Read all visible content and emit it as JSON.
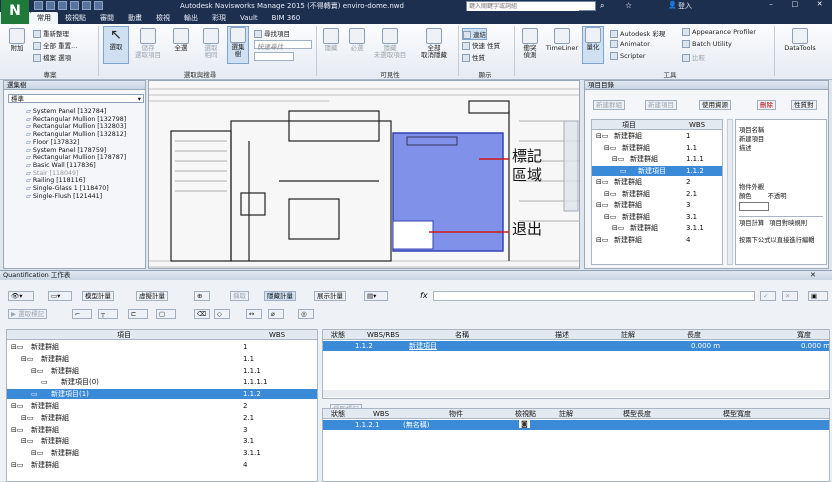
{
  "window_title": "Autodesk Navisworks Manage 2015 (不得轉賣)    enviro-dome.nwd",
  "search": {
    "placeholder": "鍵入關鍵字或詞組"
  },
  "user": {
    "name": "登入"
  },
  "ribbon_tabs": [
    "常用",
    "檢視點",
    "審閱",
    "動畫",
    "檢視",
    "輸出",
    "彩現",
    "Vault",
    "BIM 360"
  ],
  "ribbon": {
    "append": "附加",
    "refresh": "重新整理",
    "reset_all": "全部 重置...",
    "file_options": "檔案 選項",
    "select": "選取",
    "save_selection": "儲存\n選取項目",
    "select_all": "全選",
    "select_same": "選取\n相同",
    "selection_tree": "選集\n樹",
    "find_items": "尋找項目",
    "quick_find": "快速尋找",
    "hide": "隱藏",
    "require": "必選",
    "hide_unselected": "隱藏\n未選取項目",
    "unhide_all": "全部\n取消隱藏",
    "links": "連結",
    "quick_properties": "快速 性質",
    "properties": "性質",
    "clash_detective": "衝突\n偵測",
    "timeliner": "TimeLiner",
    "quantification": "量化",
    "autodesk_rendering": "Autodesk 彩現",
    "animator": "Animator",
    "scripter": "Scripter",
    "appearance_profiler": "Appearance Profiler",
    "batch_utility": "Batch Utility",
    "compare": "比較",
    "datatools": "DataTools",
    "groups": [
      "專案",
      "選取與搜尋",
      "可見性",
      "顯示",
      "工具"
    ]
  },
  "selection_tree": {
    "title": "選集樹",
    "mode": "標準",
    "items": [
      "System Panel [132784]",
      "Rectangular Mullion [132798]",
      "Rectangular Mullion [132803]",
      "Rectangular Mullion [132812]",
      "Floor [137832]",
      "System Panel [178759]",
      "Rectangular Mullion [178787]",
      "Basic Wall [117836]",
      "Stair [118049]",
      "Railing [118116]",
      "Single-Glass 1 [118470]",
      "Single-Flush [121441]"
    ]
  },
  "annotations": {
    "mark_area": "標記\n區域",
    "exit": "退出"
  },
  "item_catalog": {
    "title": "項目目錄",
    "buttons": [
      "新建群組",
      "新建項目",
      "使用資源",
      "刪除",
      "性質對"
    ],
    "columns": [
      "項目",
      "WBS"
    ],
    "rows": [
      {
        "name": "新建群組",
        "wbs": "1",
        "level": 0
      },
      {
        "name": "新建群組",
        "wbs": "1.1",
        "level": 1
      },
      {
        "name": "新建群組",
        "wbs": "1.1.1",
        "level": 2
      },
      {
        "name": "新建項目",
        "wbs": "1.1.2",
        "level": 3,
        "selected": true
      },
      {
        "name": "新建群組",
        "wbs": "2",
        "level": 0
      },
      {
        "name": "新建群組",
        "wbs": "2.1",
        "level": 1
      },
      {
        "name": "新建群組",
        "wbs": "3",
        "level": 0
      },
      {
        "name": "新建群組",
        "wbs": "3.1",
        "level": 1
      },
      {
        "name": "新建群組",
        "wbs": "3.1.1",
        "level": 2
      },
      {
        "name": "新建群組",
        "wbs": "4",
        "level": 0
      }
    ],
    "props": {
      "item_name_label": "項目名稱",
      "item_name": "新建項目",
      "desc_label": "描述",
      "appearance_label": "物件外觀",
      "color_label": "顏色",
      "transparency": "不透明",
      "tab1": "項目計算",
      "tab2": "項目對映規則",
      "hint": "按兩下公式以直接進行編輯"
    }
  },
  "quant": {
    "title": "Quantification 工作表",
    "toolbar": [
      "模型計量",
      "虛擬計量",
      "擷取",
      "隱藏計量",
      "展示計量"
    ],
    "toolbar2": [
      "選取標記"
    ],
    "fx": "fx",
    "left_columns": [
      "項目",
      "WBS"
    ],
    "left_rows": [
      {
        "name": "新建群組",
        "wbs": "1",
        "level": 0
      },
      {
        "name": "新建群組",
        "wbs": "1.1",
        "level": 1
      },
      {
        "name": "新建群組",
        "wbs": "1.1.1",
        "level": 2
      },
      {
        "name": "新建項目(0)",
        "wbs": "1.1.1.1",
        "level": 3
      },
      {
        "name": "新建項目(1)",
        "wbs": "1.1.2",
        "level": 2,
        "selected": true
      },
      {
        "name": "新建群組",
        "wbs": "2",
        "level": 0
      },
      {
        "name": "新建群組",
        "wbs": "2.1",
        "level": 1
      },
      {
        "name": "新建群組",
        "wbs": "3",
        "level": 0
      },
      {
        "name": "新建群組",
        "wbs": "3.1",
        "level": 1
      },
      {
        "name": "新建群組",
        "wbs": "3.1.1",
        "level": 2
      },
      {
        "name": "新建群組",
        "wbs": "4",
        "level": 0
      }
    ],
    "top_columns": [
      "狀態",
      "WBS/RBS",
      "名稱",
      "描述",
      "註解",
      "長度",
      "寬度"
    ],
    "top_row": {
      "wbs": "1.1.2",
      "name": "新建項目",
      "length": "0.000 m",
      "width": "0.000 m"
    },
    "render_labels": "擷取標記",
    "bottom_columns": [
      "狀態",
      "WBS",
      "物件",
      "檢視點",
      "註解",
      "模型長度",
      "模型寬度"
    ],
    "bottom_row": {
      "wbs": "1.1.2.1",
      "object": "(無名稱)"
    }
  }
}
